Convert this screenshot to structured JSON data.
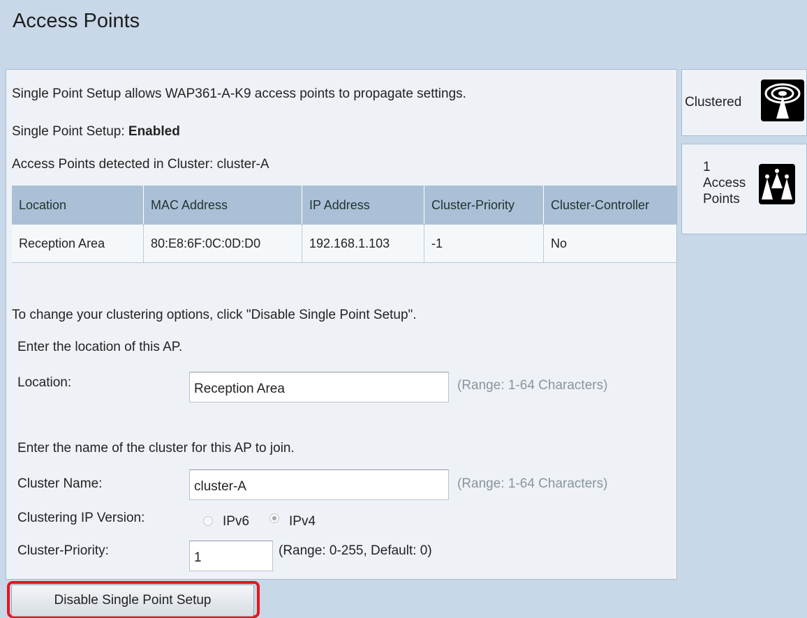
{
  "page": {
    "title": "Access Points"
  },
  "info": {
    "description": "Single Point Setup allows WAP361-A-K9 access points to propagate settings.",
    "setup_label": "Single Point Setup: ",
    "setup_value": "Enabled",
    "detected": "Access Points detected in Cluster: cluster-A"
  },
  "table": {
    "headers": [
      "Location",
      "MAC Address",
      "IP Address",
      "Cluster-Priority",
      "Cluster-Controller"
    ],
    "rows": [
      [
        "Reception Area",
        "80:E8:6F:0C:0D:D0",
        "192.168.1.103",
        "-1",
        "No"
      ]
    ]
  },
  "form": {
    "change_note": "To change your clustering options, click \"Disable Single Point Setup\".",
    "location_prompt": "Enter the location of this AP.",
    "location_label": "Location:",
    "location_value": "Reception Area",
    "location_hint": "(Range: 1-64 Characters)",
    "cluster_prompt": "Enter the name of the cluster for this AP to join.",
    "cluster_label": "Cluster Name:",
    "cluster_value": "cluster-A",
    "cluster_hint": "(Range: 1-64 Characters)",
    "ip_version_label": "Clustering IP Version:",
    "ipv6_label": "IPv6",
    "ipv4_label": "IPv4",
    "ip_version_selected": "IPv4",
    "priority_label": "Cluster-Priority:",
    "priority_value": "1",
    "priority_hint": "(Range: 0-255, Default: 0)"
  },
  "sidebar": {
    "clustered_label": "Clustered",
    "clustered_icon": "clustered-antenna-icon",
    "ap_count": "1",
    "ap_label_1": "Access",
    "ap_label_2": "Points",
    "ap_icon": "access-points-icon"
  },
  "actions": {
    "disable_label": "Disable Single Point Setup"
  },
  "colors": {
    "highlight": "#e8141c",
    "table_header": "#aac0d6",
    "page_bg": "#c8d8e8"
  }
}
